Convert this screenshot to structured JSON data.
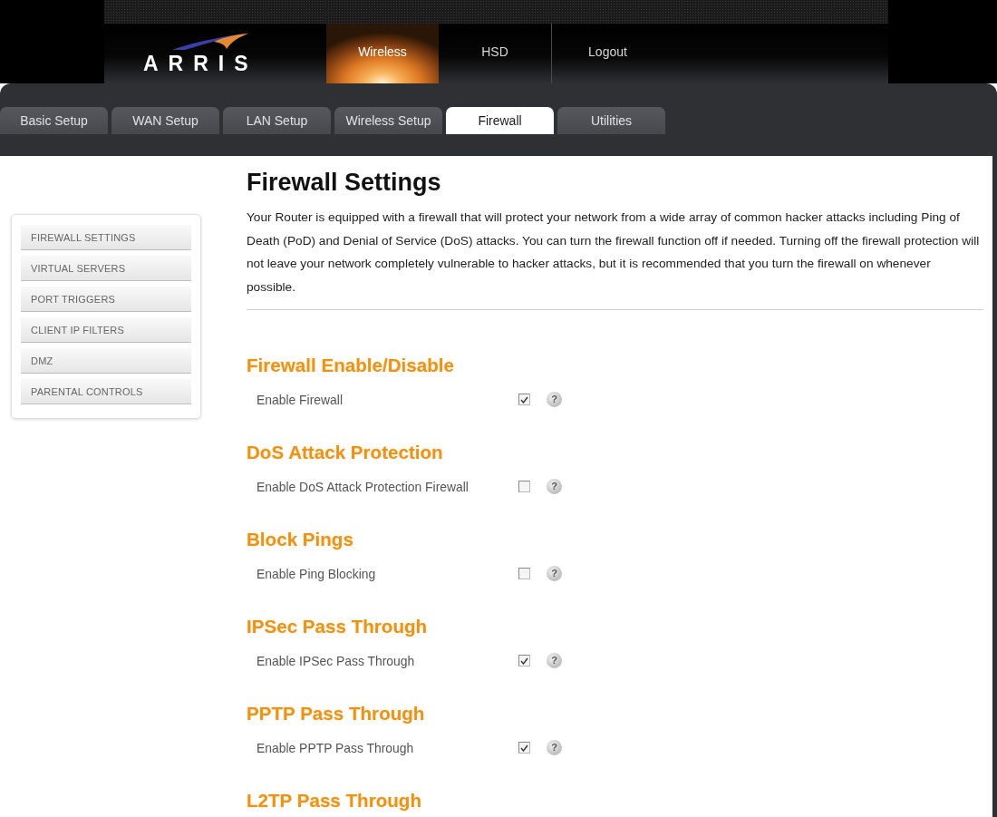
{
  "header": {
    "logo": {
      "text": "ARRIS"
    },
    "nav": [
      {
        "label": "Wireless",
        "selected": true
      },
      {
        "label": "HSD",
        "selected": false
      },
      {
        "label": "Logout",
        "selected": false
      }
    ]
  },
  "tabs": [
    {
      "label": "Basic Setup",
      "selected": false
    },
    {
      "label": "WAN Setup",
      "selected": false
    },
    {
      "label": "LAN Setup",
      "selected": false
    },
    {
      "label": "Wireless Setup",
      "selected": false
    },
    {
      "label": "Firewall",
      "selected": true
    },
    {
      "label": "Utilities",
      "selected": false
    }
  ],
  "sidebar": {
    "items": [
      {
        "label": "FIREWALL SETTINGS"
      },
      {
        "label": "VIRTUAL SERVERS"
      },
      {
        "label": "PORT TRIGGERS"
      },
      {
        "label": "CLIENT IP FILTERS"
      },
      {
        "label": "DMZ"
      },
      {
        "label": "PARENTAL CONTROLS"
      }
    ]
  },
  "page": {
    "title": "Firewall Settings",
    "intro": "Your Router is equipped with a firewall that will protect your network from a wide array of common hacker attacks including Ping of Death (PoD) and Denial of Service (DoS) attacks. You can turn the firewall function off if needed. Turning off the firewall protection will not leave your network completely vulnerable to hacker attacks, but it is recommended that you turn the firewall on whenever possible.",
    "sections": [
      {
        "heading": "Firewall Enable/Disable",
        "rows": [
          {
            "label": "Enable Firewall",
            "checked": true,
            "help": "?"
          }
        ]
      },
      {
        "heading": "DoS Attack Protection",
        "rows": [
          {
            "label": "Enable DoS Attack Protection Firewall",
            "checked": false,
            "help": "?"
          }
        ]
      },
      {
        "heading": "Block Pings",
        "rows": [
          {
            "label": "Enable Ping Blocking",
            "checked": false,
            "help": "?"
          }
        ]
      },
      {
        "heading": "IPSec Pass Through",
        "rows": [
          {
            "label": "Enable IPSec Pass Through",
            "checked": true,
            "help": "?"
          }
        ]
      },
      {
        "heading": "PPTP Pass Through",
        "rows": [
          {
            "label": "Enable PPTP Pass Through",
            "checked": true,
            "help": "?"
          }
        ]
      },
      {
        "heading": "L2TP Pass Through"
      }
    ]
  }
}
